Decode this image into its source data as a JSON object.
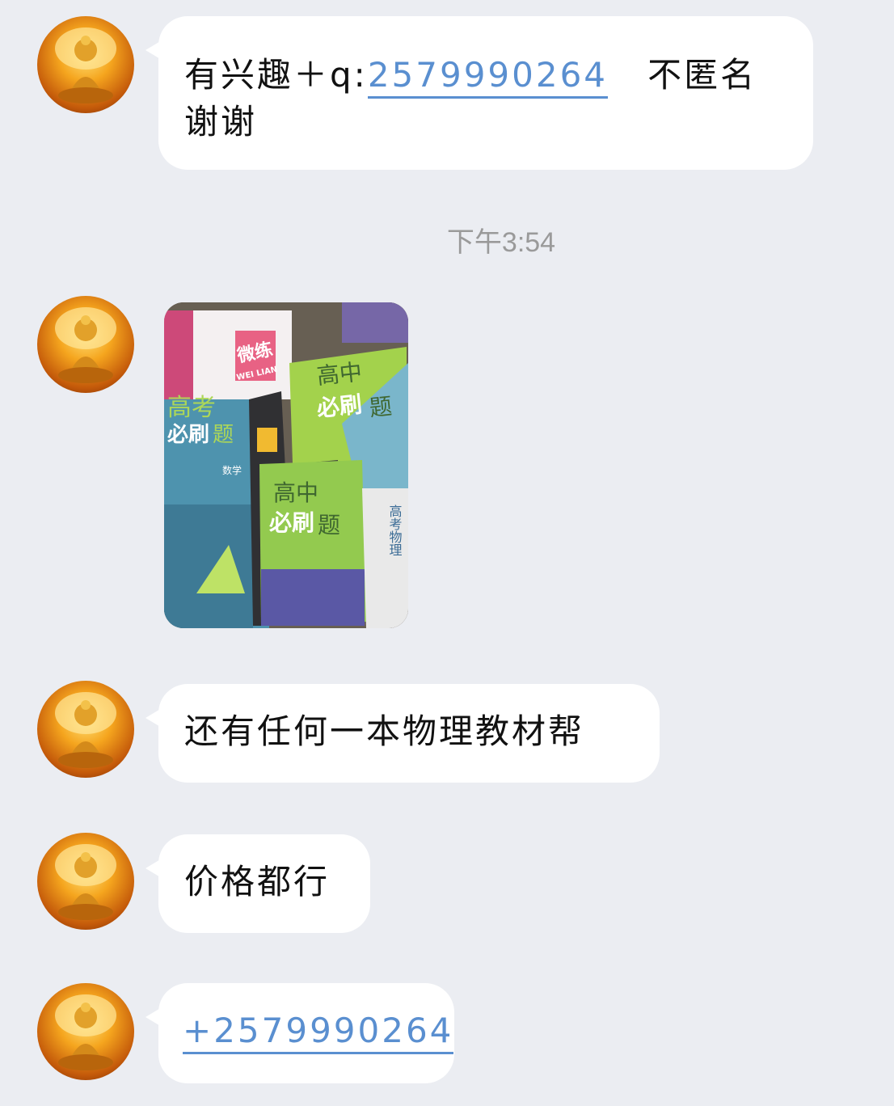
{
  "messages": [
    {
      "parts": [
        "有兴趣＋q:",
        "2579990264",
        "   不匿名",
        "谢谢"
      ]
    },
    {
      "type": "timestamp",
      "text": "下午3:54"
    },
    {
      "type": "image",
      "image": {
        "book_titles": [
          "微练",
          "WEI LIAN",
          "高中",
          "必刷",
          "题",
          "高考",
          "必刷",
          "题",
          "高中",
          "必刷",
          "题",
          "高考物理",
          "数学"
        ]
      }
    },
    {
      "text": "还有任何一本物理教材帮"
    },
    {
      "text": "价格都行"
    },
    {
      "text": "+2579990264"
    }
  ],
  "colors": {
    "background": "#ebedf2",
    "bubble": "#ffffff",
    "link": "#5a8fd0",
    "timestamp": "#9a9a9a"
  },
  "icons": [
    "buddha-avatar-icon"
  ]
}
